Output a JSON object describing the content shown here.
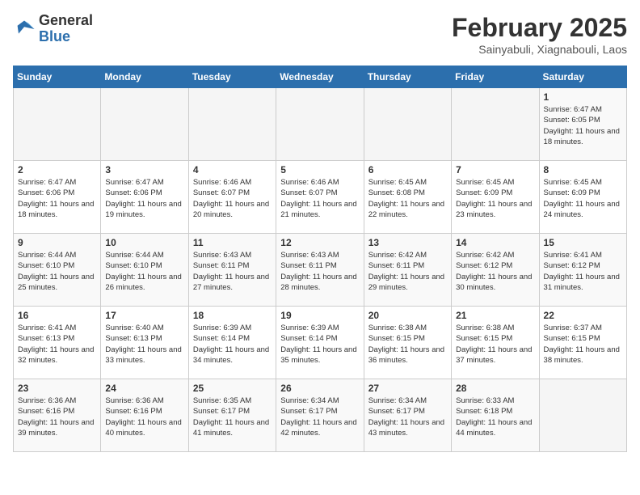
{
  "header": {
    "logo": {
      "general": "General",
      "blue": "Blue"
    },
    "title": "February 2025",
    "subtitle": "Sainyabuli, Xiagnabouli, Laos"
  },
  "calendar": {
    "days_of_week": [
      "Sunday",
      "Monday",
      "Tuesday",
      "Wednesday",
      "Thursday",
      "Friday",
      "Saturday"
    ],
    "weeks": [
      [
        {
          "day": "",
          "info": ""
        },
        {
          "day": "",
          "info": ""
        },
        {
          "day": "",
          "info": ""
        },
        {
          "day": "",
          "info": ""
        },
        {
          "day": "",
          "info": ""
        },
        {
          "day": "",
          "info": ""
        },
        {
          "day": "1",
          "info": "Sunrise: 6:47 AM\nSunset: 6:05 PM\nDaylight: 11 hours and 18 minutes."
        }
      ],
      [
        {
          "day": "2",
          "info": "Sunrise: 6:47 AM\nSunset: 6:06 PM\nDaylight: 11 hours and 18 minutes."
        },
        {
          "day": "3",
          "info": "Sunrise: 6:47 AM\nSunset: 6:06 PM\nDaylight: 11 hours and 19 minutes."
        },
        {
          "day": "4",
          "info": "Sunrise: 6:46 AM\nSunset: 6:07 PM\nDaylight: 11 hours and 20 minutes."
        },
        {
          "day": "5",
          "info": "Sunrise: 6:46 AM\nSunset: 6:07 PM\nDaylight: 11 hours and 21 minutes."
        },
        {
          "day": "6",
          "info": "Sunrise: 6:45 AM\nSunset: 6:08 PM\nDaylight: 11 hours and 22 minutes."
        },
        {
          "day": "7",
          "info": "Sunrise: 6:45 AM\nSunset: 6:09 PM\nDaylight: 11 hours and 23 minutes."
        },
        {
          "day": "8",
          "info": "Sunrise: 6:45 AM\nSunset: 6:09 PM\nDaylight: 11 hours and 24 minutes."
        }
      ],
      [
        {
          "day": "9",
          "info": "Sunrise: 6:44 AM\nSunset: 6:10 PM\nDaylight: 11 hours and 25 minutes."
        },
        {
          "day": "10",
          "info": "Sunrise: 6:44 AM\nSunset: 6:10 PM\nDaylight: 11 hours and 26 minutes."
        },
        {
          "day": "11",
          "info": "Sunrise: 6:43 AM\nSunset: 6:11 PM\nDaylight: 11 hours and 27 minutes."
        },
        {
          "day": "12",
          "info": "Sunrise: 6:43 AM\nSunset: 6:11 PM\nDaylight: 11 hours and 28 minutes."
        },
        {
          "day": "13",
          "info": "Sunrise: 6:42 AM\nSunset: 6:11 PM\nDaylight: 11 hours and 29 minutes."
        },
        {
          "day": "14",
          "info": "Sunrise: 6:42 AM\nSunset: 6:12 PM\nDaylight: 11 hours and 30 minutes."
        },
        {
          "day": "15",
          "info": "Sunrise: 6:41 AM\nSunset: 6:12 PM\nDaylight: 11 hours and 31 minutes."
        }
      ],
      [
        {
          "day": "16",
          "info": "Sunrise: 6:41 AM\nSunset: 6:13 PM\nDaylight: 11 hours and 32 minutes."
        },
        {
          "day": "17",
          "info": "Sunrise: 6:40 AM\nSunset: 6:13 PM\nDaylight: 11 hours and 33 minutes."
        },
        {
          "day": "18",
          "info": "Sunrise: 6:39 AM\nSunset: 6:14 PM\nDaylight: 11 hours and 34 minutes."
        },
        {
          "day": "19",
          "info": "Sunrise: 6:39 AM\nSunset: 6:14 PM\nDaylight: 11 hours and 35 minutes."
        },
        {
          "day": "20",
          "info": "Sunrise: 6:38 AM\nSunset: 6:15 PM\nDaylight: 11 hours and 36 minutes."
        },
        {
          "day": "21",
          "info": "Sunrise: 6:38 AM\nSunset: 6:15 PM\nDaylight: 11 hours and 37 minutes."
        },
        {
          "day": "22",
          "info": "Sunrise: 6:37 AM\nSunset: 6:15 PM\nDaylight: 11 hours and 38 minutes."
        }
      ],
      [
        {
          "day": "23",
          "info": "Sunrise: 6:36 AM\nSunset: 6:16 PM\nDaylight: 11 hours and 39 minutes."
        },
        {
          "day": "24",
          "info": "Sunrise: 6:36 AM\nSunset: 6:16 PM\nDaylight: 11 hours and 40 minutes."
        },
        {
          "day": "25",
          "info": "Sunrise: 6:35 AM\nSunset: 6:17 PM\nDaylight: 11 hours and 41 minutes."
        },
        {
          "day": "26",
          "info": "Sunrise: 6:34 AM\nSunset: 6:17 PM\nDaylight: 11 hours and 42 minutes."
        },
        {
          "day": "27",
          "info": "Sunrise: 6:34 AM\nSunset: 6:17 PM\nDaylight: 11 hours and 43 minutes."
        },
        {
          "day": "28",
          "info": "Sunrise: 6:33 AM\nSunset: 6:18 PM\nDaylight: 11 hours and 44 minutes."
        },
        {
          "day": "",
          "info": ""
        }
      ]
    ]
  }
}
